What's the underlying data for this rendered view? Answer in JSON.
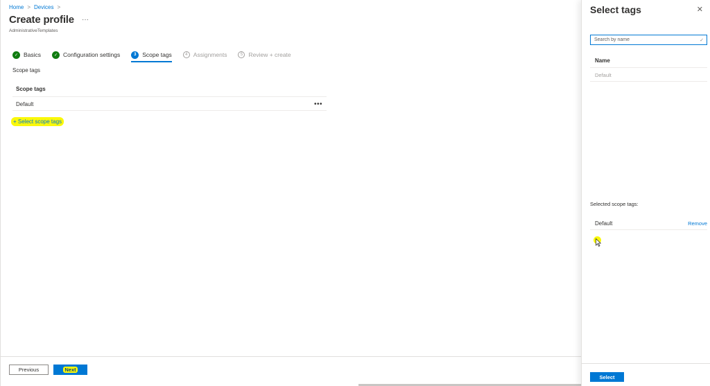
{
  "breadcrumb": {
    "home": "Home",
    "devices": "Devices",
    "sep": ">"
  },
  "header": {
    "title": "Create profile",
    "more": "···",
    "subtitle": "AdministrativeTemplates"
  },
  "steps": [
    {
      "num": "✓",
      "label": "Basics",
      "state": "done"
    },
    {
      "num": "✓",
      "label": "Configuration settings",
      "state": "done"
    },
    {
      "num": "3",
      "label": "Scope tags",
      "state": "active"
    },
    {
      "num": "4",
      "label": "Assignments",
      "state": "future"
    },
    {
      "num": "5",
      "label": "Review + create",
      "state": "future"
    }
  ],
  "scope": {
    "section_label": "Scope tags",
    "column_header": "Scope tags",
    "rows": [
      {
        "name": "Default",
        "more": "•••"
      }
    ],
    "add_link": "+ Select scope tags"
  },
  "footer": {
    "previous": "Previous",
    "next": "Next"
  },
  "panel": {
    "title": "Select tags",
    "close": "✕",
    "search_placeholder": "Search by name",
    "column_name": "Name",
    "results": [
      "Default"
    ],
    "selected_header": "Selected scope tags:",
    "selected": [
      {
        "name": "Default",
        "action": "Remove"
      }
    ],
    "select_button": "Select"
  },
  "colors": {
    "accent": "#0078d4",
    "success": "#107c10",
    "highlight": "#faf80a"
  }
}
